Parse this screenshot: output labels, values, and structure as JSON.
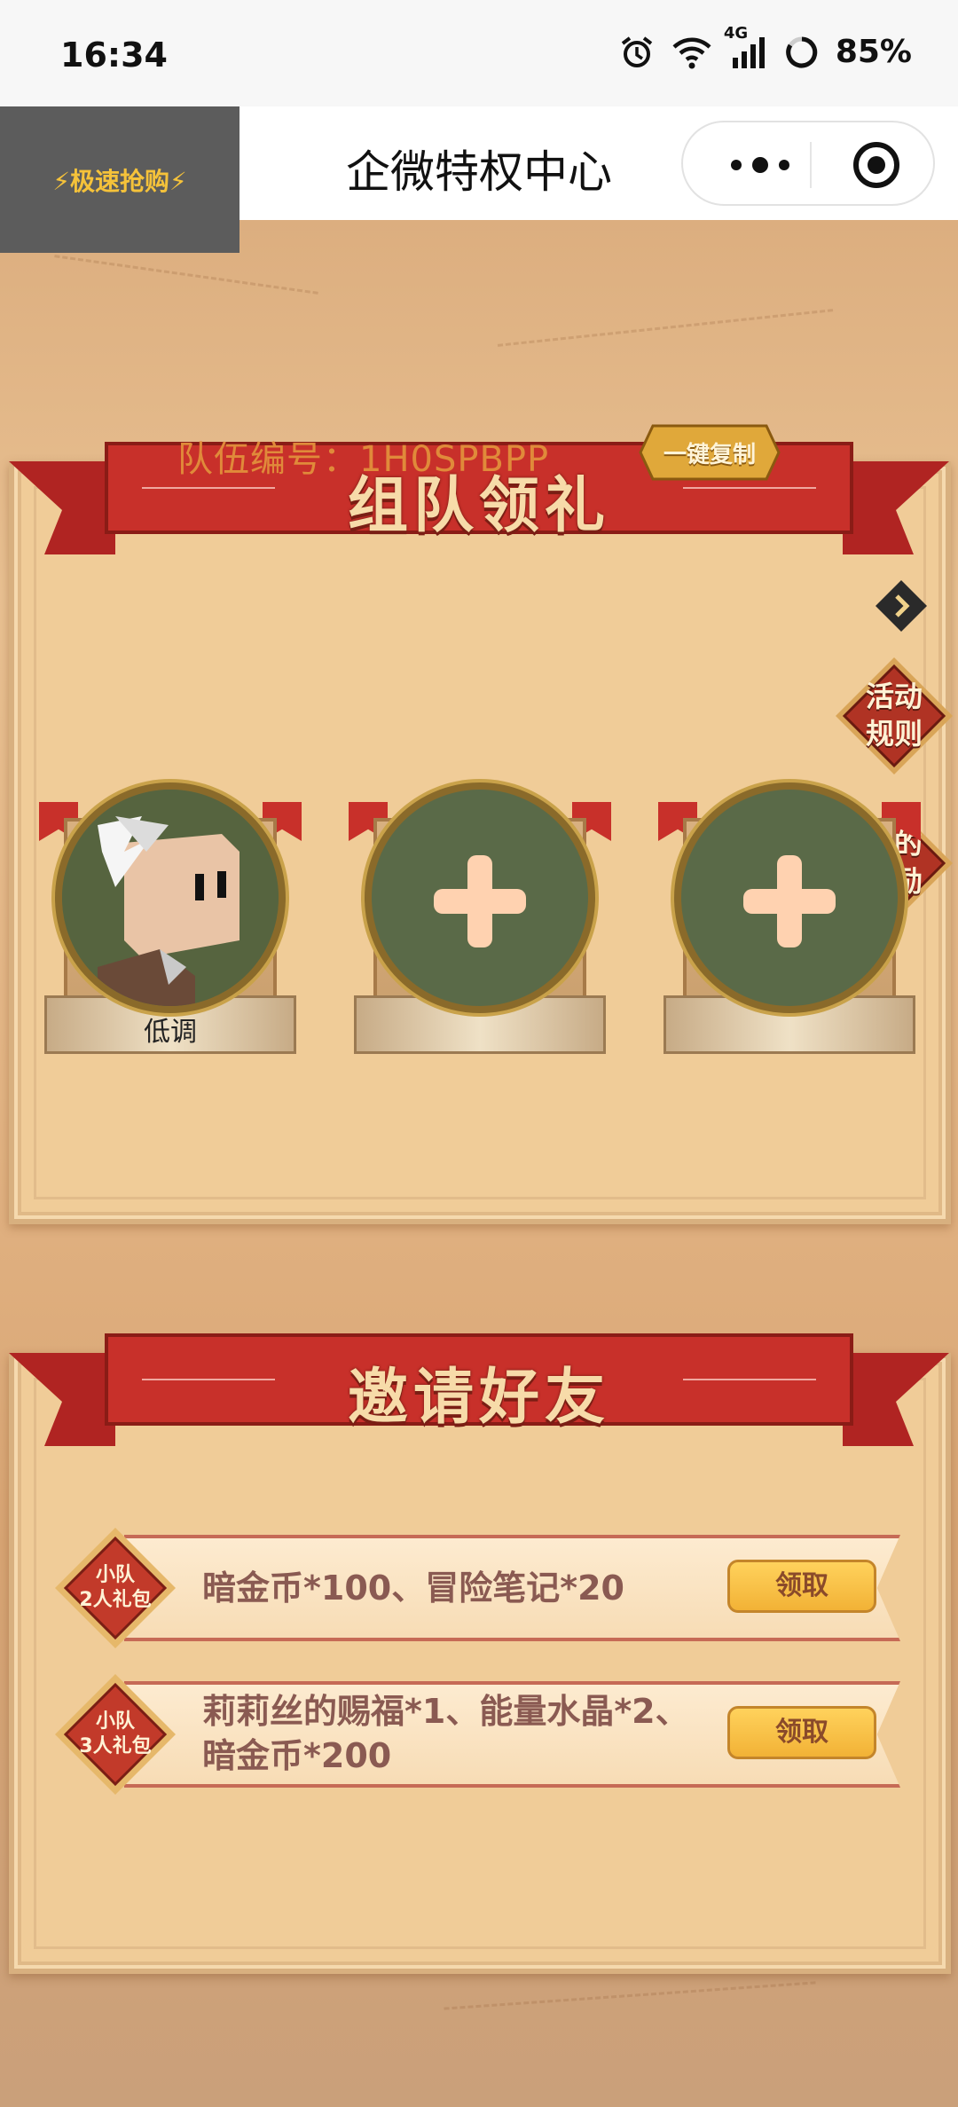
{
  "status_bar": {
    "time": "16:34",
    "network": "4G",
    "battery": "85%"
  },
  "header": {
    "flash_badge": "⚡极速抢购⚡",
    "title": "企微特权中心"
  },
  "team_section": {
    "banner_title": "组队领礼",
    "team_id": "队伍编号：1H0SPBPP",
    "copy_button": "一键复制",
    "side_buttons": {
      "rules": [
        "活动",
        "规则"
      ],
      "rewards": [
        "我的",
        "奖励"
      ]
    },
    "slots": [
      {
        "filled": true,
        "name": "低调"
      },
      {
        "filled": false,
        "name": ""
      },
      {
        "filled": false,
        "name": ""
      }
    ]
  },
  "invite_section": {
    "banner_title": "邀请好友",
    "rewards": [
      {
        "badge": [
          "小队",
          "2人礼包"
        ],
        "lines": [
          "暗金币*100、冒险笔记*20"
        ],
        "button": "领取"
      },
      {
        "badge": [
          "小队",
          "3人礼包"
        ],
        "lines": [
          "莉莉丝的赐福*1、能量水晶*2、",
          "暗金币*200"
        ],
        "button": "领取"
      }
    ]
  },
  "colors": {
    "banner_red": "#c8302a",
    "accent_gold": "#f2b236",
    "card_bg": "#f0cc98"
  }
}
